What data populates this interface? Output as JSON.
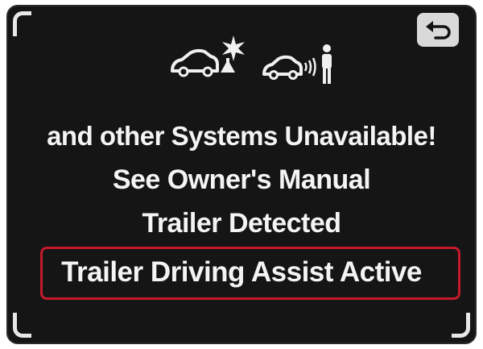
{
  "screen": {
    "icons": [
      {
        "name": "car-sign-recognition-icon"
      },
      {
        "name": "car-pedestrian-detection-icon"
      }
    ],
    "back_icon": "return-arrow-icon"
  },
  "messages": {
    "line1": "and other Systems Unavailable!",
    "line2": "See Owner's Manual",
    "line3": "Trailer Detected",
    "line4": "Trailer Driving Assist Active"
  },
  "colors": {
    "screen_background": "#151515",
    "text": "#f4f4f4",
    "highlight_border": "#c4192b",
    "back_button": "#d9d9d9"
  }
}
